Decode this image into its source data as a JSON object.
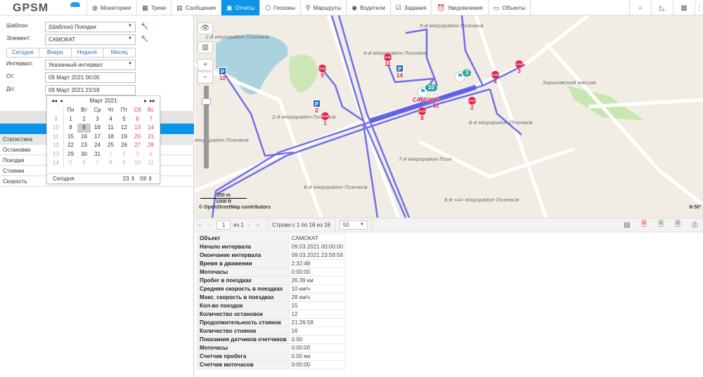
{
  "header": {
    "logo": "GPSM",
    "nav": [
      {
        "label": "Мониторинг",
        "icon": "globe-icon"
      },
      {
        "label": "Треки",
        "icon": "track-icon"
      },
      {
        "label": "Сообщения",
        "icon": "messages-icon"
      },
      {
        "label": "Отчеты",
        "icon": "reports-icon",
        "active": true
      },
      {
        "label": "Геозоны",
        "icon": "geofence-icon"
      },
      {
        "label": "Маршруты",
        "icon": "route-icon"
      },
      {
        "label": "Водители",
        "icon": "driver-icon"
      },
      {
        "label": "Задания",
        "icon": "tasks-icon"
      },
      {
        "label": "Уведомления",
        "icon": "alarm-icon"
      },
      {
        "label": "Объекты",
        "icon": "bus-icon"
      }
    ],
    "tools": [
      "search-icon",
      "ruler-icon",
      "grid-icon",
      "more-icon"
    ]
  },
  "form": {
    "template_label": "Шаблон:",
    "template_value": "(Шаблон) Поездки",
    "element_label": "Элемент:",
    "element_value": "САМОКАТ",
    "quick": [
      "Сегодня",
      "Вчера",
      "Неделя",
      "Месяц"
    ],
    "interval_label": "Интервал:",
    "interval_value": "Указанный интервал",
    "from_label": "От:",
    "from_value": "09 Март 2021 00:00",
    "to_label": "До:",
    "to_value": "09 Март 2021 23:59"
  },
  "calendar": {
    "title": "Март 2021",
    "weekdays": [
      "Пн",
      "Вт",
      "Ср",
      "Чт",
      "Пт",
      "Сб",
      "Вс"
    ],
    "weeks": [
      {
        "n": "9",
        "d": [
          "1",
          "2",
          "3",
          "4",
          "5",
          "6",
          "7"
        ]
      },
      {
        "n": "10",
        "d": [
          "8",
          "9",
          "10",
          "11",
          "12",
          "13",
          "14"
        ]
      },
      {
        "n": "11",
        "d": [
          "15",
          "16",
          "17",
          "18",
          "19",
          "20",
          "21"
        ]
      },
      {
        "n": "12",
        "d": [
          "22",
          "23",
          "24",
          "25",
          "26",
          "27",
          "28"
        ]
      },
      {
        "n": "13",
        "d": [
          "29",
          "30",
          "31",
          "1",
          "2",
          "3",
          "4"
        ]
      },
      {
        "n": "14",
        "d": [
          "5",
          "6",
          "7",
          "8",
          "9",
          "10",
          "11"
        ]
      }
    ],
    "today_label": "Сегодня",
    "hour": "23",
    "minute": "59",
    "selected": "9",
    "today": "10"
  },
  "report_items": [
    "Статистика",
    "Остановки",
    "Поездки",
    "Стоянки",
    "Скорость"
  ],
  "map": {
    "attribution": "© OpenStreetMap contributors",
    "scale_m": "200 m",
    "scale_ft": "1000 ft",
    "compass": "N 50°",
    "object_label": "САМОКАТ",
    "districts": [
      "1-й мікрорайон Позняків",
      "2-й мікрорайон Позняків",
      "4-й мікрорайон Позняків",
      "5-й мікрорайон Позняків",
      "6-й мікрорайон Позняків",
      "7-й мікрорайон Позн",
      "8-й мікрорайон Позняків",
      "6-й «А» мікрорайон Позняків",
      "Харьковский массив",
      "мікрорайон Позняків"
    ],
    "stops": [
      "9",
      "1",
      "11",
      "8",
      "4",
      "3",
      "2"
    ],
    "parkings": [
      "10",
      "2",
      "14",
      "11"
    ],
    "clusters": [
      "10",
      "3"
    ]
  },
  "toolbar": {
    "page": "1",
    "of": "из 1",
    "rows": "Строки с 1 по 16 из 16",
    "per_page": "50"
  },
  "table": [
    [
      "Объект",
      "САМОКАТ"
    ],
    [
      "Начало интервала",
      "09.03.2021 00:00:00"
    ],
    [
      "Окончание интервала",
      "09.03.2021 23:59:59"
    ],
    [
      "Время в движении",
      "2:32:48"
    ],
    [
      "Моточасы",
      "0:00:00"
    ],
    [
      "Пробег в поездках",
      "26.39 км"
    ],
    [
      "Средняя скорость в поездках",
      "10 км/ч"
    ],
    [
      "Макс. скорость в поездках",
      "28 км/ч"
    ],
    [
      "Кол-во поездок",
      "15"
    ],
    [
      "Количество остановок",
      "12"
    ],
    [
      "Продолжительность стоянок",
      "21:26:58"
    ],
    [
      "Количество стоянок",
      "16"
    ],
    [
      "Показания датчиков счетчиков",
      "0.00"
    ],
    [
      "Моточасы",
      "0:00:00"
    ],
    [
      "Счетчик пробега",
      "0.00 км"
    ],
    [
      "Счетчик моточасов",
      "0:00:00"
    ]
  ]
}
